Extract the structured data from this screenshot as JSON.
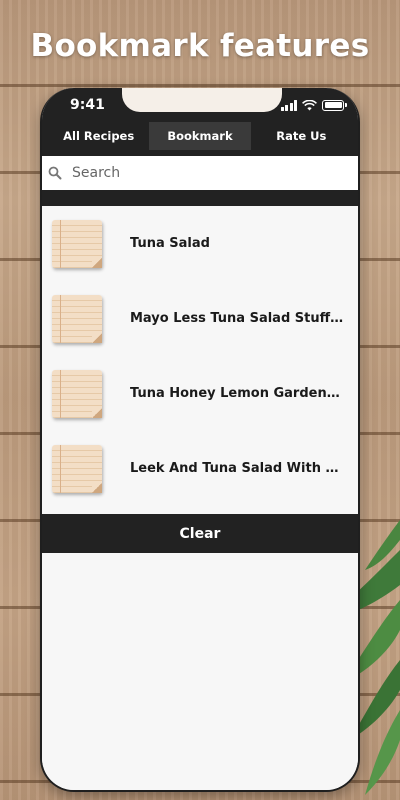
{
  "hero_title": "Bookmark features",
  "status": {
    "time": "9:41"
  },
  "tabs": [
    {
      "label": "All Recipes"
    },
    {
      "label": "Bookmark",
      "active": true
    },
    {
      "label": "Rate Us"
    }
  ],
  "search": {
    "placeholder": "Search",
    "value": ""
  },
  "bookmarks": [
    {
      "title": "Tuna Salad"
    },
    {
      "title": "Mayo Less Tuna Salad Stuffed A..."
    },
    {
      "title": "Tuna Honey Lemon Garden Salad"
    },
    {
      "title": "Leek And Tuna Salad With Vine..."
    }
  ],
  "clear_label": "Clear",
  "colors": {
    "bar": "#222222",
    "active_tab": "#3a3a3a",
    "screen_bg": "#f7f7f7"
  },
  "icons": {
    "search": "search-icon",
    "thumbnail": "note-paper-icon"
  }
}
